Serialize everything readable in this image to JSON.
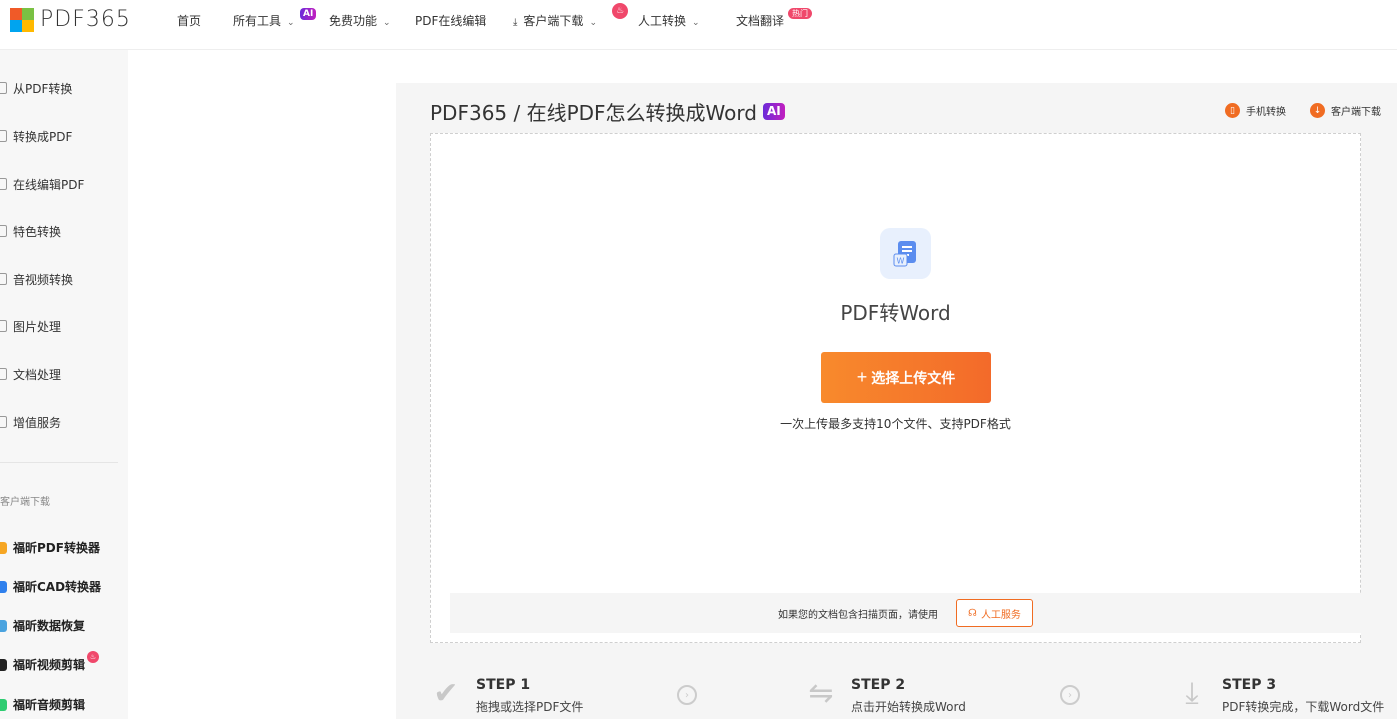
{
  "brand": {
    "name": "PDF365",
    "colors": [
      "#f05a28",
      "#7ac143",
      "#00a4ef",
      "#ffb900"
    ]
  },
  "nav": {
    "home": "首页",
    "all_tools": "所有工具",
    "all_tools_badge": "AI",
    "free_features": "免费功能",
    "online_edit": "PDF在线编辑",
    "client_download": "客户端下载",
    "manual_convert": "人工转换",
    "doc_translate": "文档翻译",
    "doc_translate_badge": "热门"
  },
  "sidebar": {
    "items": [
      {
        "label": "从PDF转换"
      },
      {
        "label": "转换成PDF"
      },
      {
        "label": "在线编辑PDF"
      },
      {
        "label": "特色转换"
      },
      {
        "label": "音视频转换"
      },
      {
        "label": "图片处理"
      },
      {
        "label": "文档处理"
      },
      {
        "label": "增值服务"
      }
    ],
    "client_heading": "客户端下载",
    "apps": [
      {
        "label": "福昕PDF转换器",
        "color": "#f6a623"
      },
      {
        "label": "福昕CAD转换器",
        "color": "#2f80ed"
      },
      {
        "label": "福昕数据恢复",
        "color": "#4aa3df"
      },
      {
        "label": "福昕视频剪辑",
        "color": "#222222"
      },
      {
        "label": "福昕音频剪辑",
        "color": "#2ecc71"
      }
    ]
  },
  "main": {
    "title": "PDF365 / 在线PDF怎么转换成Word",
    "title_badge": "AI",
    "mobile_convert": "手机转换",
    "client_download": "客户端下载",
    "tool_name": "PDF转Word",
    "upload_button": "选择上传文件",
    "upload_note": "一次上传最多支持10个文件、支持PDF格式",
    "scan_note": "如果您的文档包含扫描页面，请使用",
    "manual_service": "人工服务",
    "accent": "#f06c22"
  },
  "steps": [
    {
      "title": "STEP 1",
      "desc": "拖拽或选择PDF文件",
      "icon": "check-icon"
    },
    {
      "title": "STEP 2",
      "desc": "点击开始转换成Word",
      "icon": "exchange-icon"
    },
    {
      "title": "STEP 3",
      "desc": "PDF转换完成，下载Word文件",
      "icon": "download-icon"
    }
  ]
}
